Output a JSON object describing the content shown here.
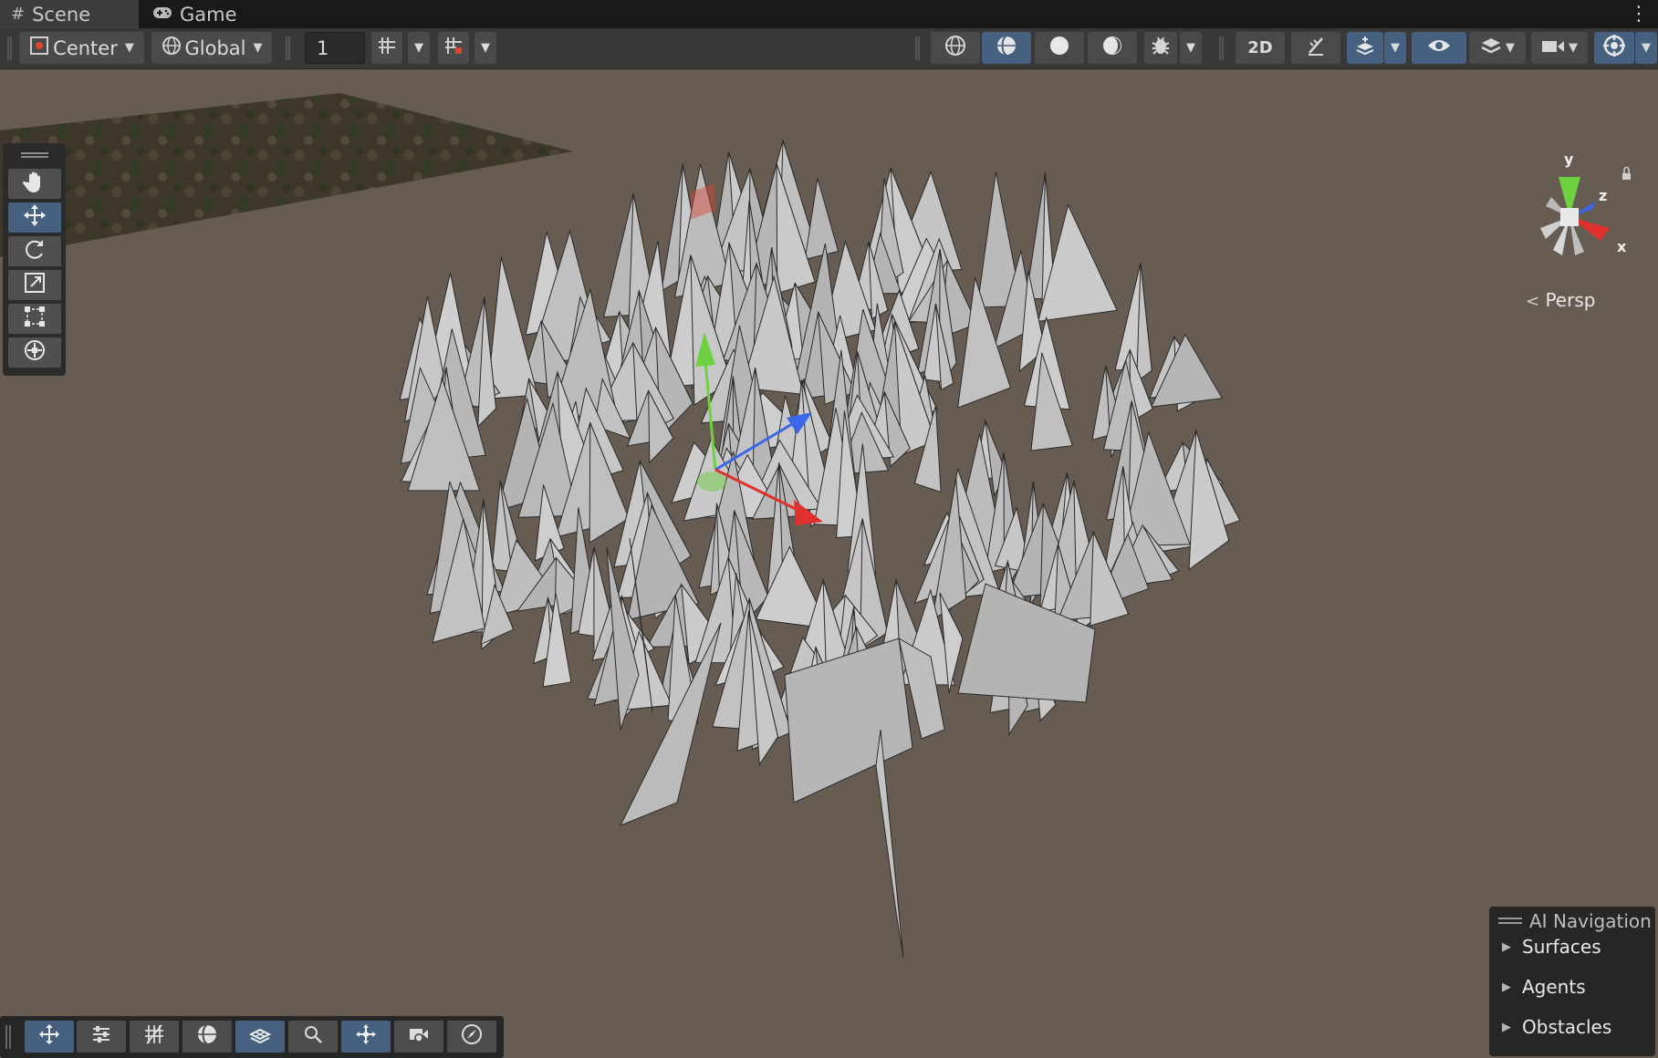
{
  "tabs": [
    {
      "label": "Scene",
      "icon": "hash-icon",
      "active": true
    },
    {
      "label": "Game",
      "icon": "gamepad-icon",
      "active": false
    }
  ],
  "toolbar": {
    "pivot_mode": "Center",
    "pivot_rotation": "Global",
    "snap_increment": "1"
  },
  "view": {
    "projection_label": "Persp",
    "axis_labels": {
      "y": "y",
      "z": "z",
      "x": "x"
    }
  },
  "ai_navigation": {
    "title": "AI Navigation",
    "items": [
      "Surfaces",
      "Agents",
      "Obstacles"
    ]
  },
  "colors": {
    "background": "#675c51",
    "accent": "#46607f",
    "mesh": "#c4c4c4",
    "axis_x": "#e0312e",
    "axis_y": "#6ed140",
    "axis_z": "#3a66e8"
  }
}
